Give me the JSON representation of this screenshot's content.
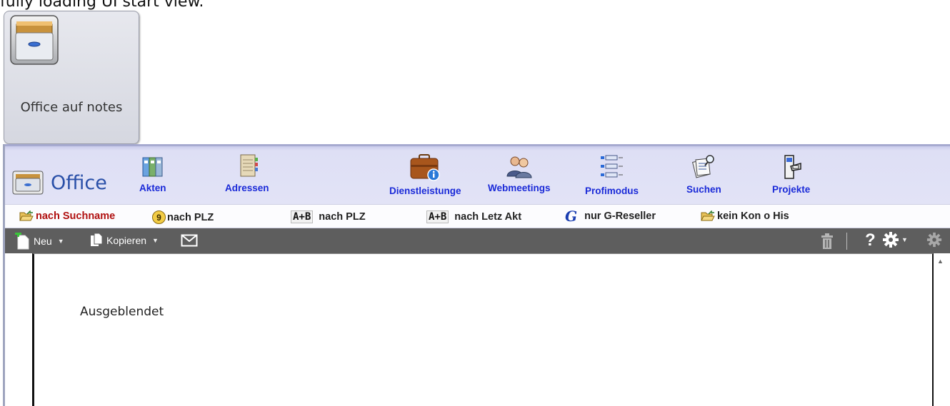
{
  "top_partial_text": "fully loading UI start view.",
  "tile": {
    "label": "Office auf notes",
    "icon": "file-cabinet-icon"
  },
  "app": {
    "title": "Office",
    "nav": [
      {
        "label": "Akten",
        "icon": "binders-icon"
      },
      {
        "label": "Adressen",
        "icon": "address-book-icon"
      },
      {
        "label": "Dienstleistunge",
        "icon": "briefcase-info-icon"
      },
      {
        "label": "Webmeetings",
        "icon": "people-icon"
      },
      {
        "label": "Profimodus",
        "icon": "tree-list-icon"
      },
      {
        "label": "Suchen",
        "icon": "search-documents-icon"
      },
      {
        "label": "Projekte",
        "icon": "project-binder-icon"
      }
    ],
    "filters": [
      {
        "label": "nach Suchname"
      },
      {
        "badge": "9",
        "label": "nach PLZ"
      },
      {
        "badge": "A+B",
        "label": "nach PLZ"
      },
      {
        "badge": "A+B",
        "label": "nach Letz Akt"
      },
      {
        "badge": "G",
        "label": "nur G-Reseller"
      },
      {
        "label": "kein Kon o His"
      }
    ],
    "toolbar": {
      "new_label": "Neu",
      "copy_label": "Kopieren",
      "help_label": "?"
    },
    "content": {
      "text": "Ausgeblendet"
    }
  },
  "colors": {
    "nav_text": "#1a2ad8",
    "active_filter": "#b01010",
    "toolbar_bg": "#5e5e5e",
    "header_bg": "#dedff5"
  }
}
